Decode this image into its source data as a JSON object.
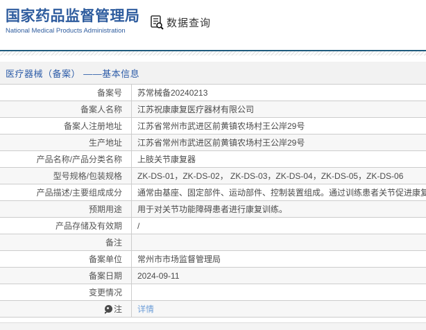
{
  "header": {
    "org_name_cn": "国家药品监督管理局",
    "org_name_en": "National Medical Products Administration",
    "nav_title": "数据查询"
  },
  "section": {
    "title": "医疗器械（备案） ——基本信息"
  },
  "table": {
    "rows": [
      {
        "label": "备案号",
        "value": "苏常械备20240213"
      },
      {
        "label": "备案人名称",
        "value": "江苏祝康康复医疗器材有限公司"
      },
      {
        "label": "备案人注册地址",
        "value": "江苏省常州市武进区前黄镇农场村王公岸29号"
      },
      {
        "label": "生产地址",
        "value": "江苏省常州市武进区前黄镇农场村王公岸29号"
      },
      {
        "label": "产品名称/产品分类名称",
        "value": "上肢关节康复器"
      },
      {
        "label": "型号规格/包装规格",
        "value": "ZK-DS-01，ZK-DS-02， ZK-DS-03，ZK-DS-04，ZK-DS-05，ZK-DS-06"
      },
      {
        "label": "产品描述/主要组成成分",
        "value": "通常由基座、固定部件、运动部件、控制装置组成。通过训练患者关节促进康复。无源产品。"
      },
      {
        "label": "预期用途",
        "value": "用于对关节功能障碍患者进行康复训练。"
      },
      {
        "label": "产品存储及有效期",
        "value": "/"
      },
      {
        "label": "备注",
        "value": ""
      },
      {
        "label": "备案单位",
        "value": "常州市市场监督管理局"
      },
      {
        "label": "备案日期",
        "value": "2024-09-11"
      },
      {
        "label": "变更情况",
        "value": ""
      },
      {
        "label": "注",
        "value": "详情",
        "value_is_link": true,
        "label_icon": "note-bubble-icon"
      }
    ]
  },
  "colors": {
    "brand_blue": "#2e5c9e",
    "section_title_blue": "#2d5ca8",
    "divider_teal": "#1e5a7d",
    "link_blue": "#6f9fd8",
    "row_alt_bg": "#f7f7f7",
    "border_gray": "#cccccc",
    "section_bar_bg": "#f2f2f2"
  }
}
